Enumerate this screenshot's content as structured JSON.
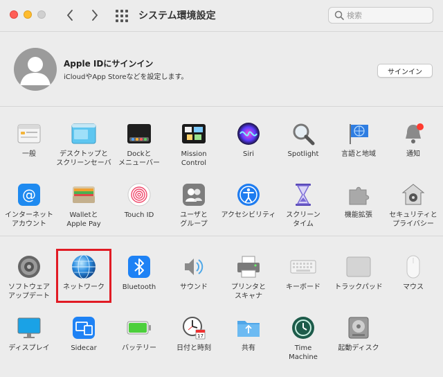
{
  "window": {
    "title": "システム環境設定",
    "search_placeholder": "検索"
  },
  "apple_id": {
    "title": "Apple IDにサインイン",
    "subtitle": "iCloudやApp Storeなどを設定します。",
    "signin_label": "サインイン"
  },
  "row1": [
    {
      "label": "一般",
      "icon": "general-icon"
    },
    {
      "label": "デスクトップと\nスクリーンセーバ",
      "icon": "desktop-icon"
    },
    {
      "label": "Dockと\nメニューバー",
      "icon": "dock-icon"
    },
    {
      "label": "Mission\nControl",
      "icon": "mission-control-icon"
    },
    {
      "label": "Siri",
      "icon": "siri-icon"
    },
    {
      "label": "Spotlight",
      "icon": "spotlight-icon"
    },
    {
      "label": "言語と地域",
      "icon": "language-region-icon"
    },
    {
      "label": "通知",
      "icon": "notifications-icon"
    }
  ],
  "row2": [
    {
      "label": "インターネット\nアカウント",
      "icon": "internet-accounts-icon"
    },
    {
      "label": "Walletと\nApple Pay",
      "icon": "wallet-icon"
    },
    {
      "label": "Touch ID",
      "icon": "touch-id-icon"
    },
    {
      "label": "ユーザと\nグループ",
      "icon": "users-groups-icon"
    },
    {
      "label": "アクセシビリティ",
      "icon": "accessibility-icon"
    },
    {
      "label": "スクリーン\nタイム",
      "icon": "screen-time-icon"
    },
    {
      "label": "機能拡張",
      "icon": "extensions-icon"
    },
    {
      "label": "セキュリティと\nプライバシー",
      "icon": "security-icon"
    }
  ],
  "row3": [
    {
      "label": "ソフトウェア\nアップデート",
      "icon": "software-update-icon"
    },
    {
      "label": "ネットワーク",
      "icon": "network-icon"
    },
    {
      "label": "Bluetooth",
      "icon": "bluetooth-icon"
    },
    {
      "label": "サウンド",
      "icon": "sound-icon"
    },
    {
      "label": "プリンタと\nスキャナ",
      "icon": "printer-icon"
    },
    {
      "label": "キーボード",
      "icon": "keyboard-icon"
    },
    {
      "label": "トラックパッド",
      "icon": "trackpad-icon"
    },
    {
      "label": "マウス",
      "icon": "mouse-icon"
    }
  ],
  "row4": [
    {
      "label": "ディスプレイ",
      "icon": "displays-icon"
    },
    {
      "label": "Sidecar",
      "icon": "sidecar-icon"
    },
    {
      "label": "バッテリー",
      "icon": "battery-icon"
    },
    {
      "label": "日付と時刻",
      "icon": "date-time-icon"
    },
    {
      "label": "共有",
      "icon": "sharing-icon"
    },
    {
      "label": "Time\nMachine",
      "icon": "time-machine-icon"
    },
    {
      "label": "起動ディスク",
      "icon": "startup-disk-icon"
    }
  ],
  "colors": {
    "highlight": "#e11b24",
    "close": "#ff5f57",
    "minimize": "#febc2e"
  }
}
